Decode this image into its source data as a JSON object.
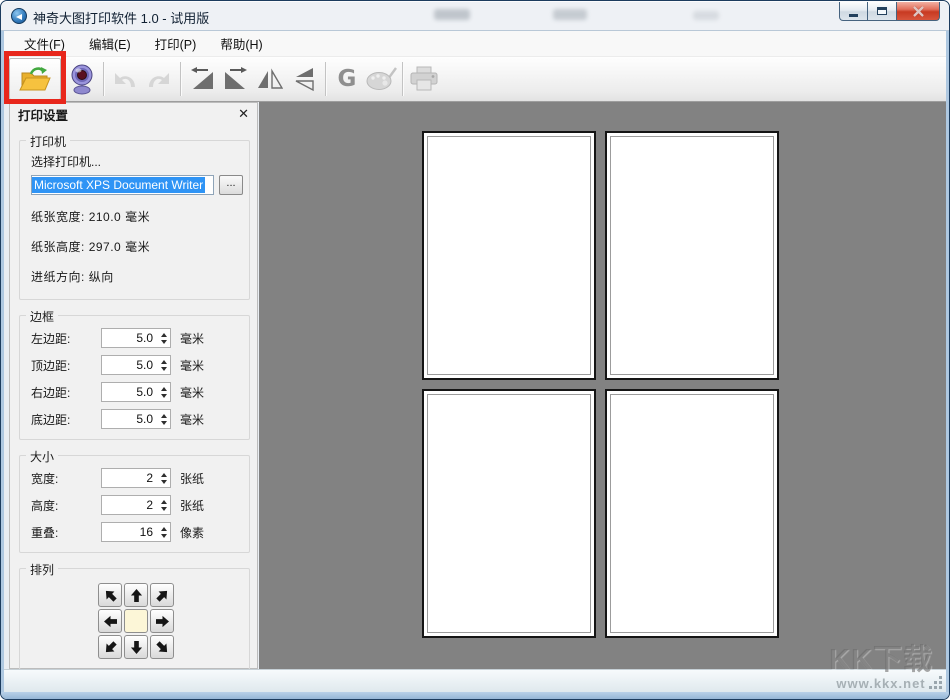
{
  "window": {
    "title": "神奇大图打印软件 1.0 - 试用版"
  },
  "menu": {
    "items": [
      {
        "label": "文件(F)"
      },
      {
        "label": "编辑(E)"
      },
      {
        "label": "打印(P)"
      },
      {
        "label": "帮助(H)"
      }
    ]
  },
  "toolbar": {
    "grayscale_label": "G"
  },
  "panel": {
    "title": "打印设置",
    "close_glyph": "✕",
    "printer_group": {
      "label": "打印机",
      "select_label": "选择打印机...",
      "printer_name": "Microsoft XPS Document Writer",
      "browse_label": "...",
      "paper_width": {
        "label": "纸张宽度:",
        "value": "210.0",
        "unit": "毫米"
      },
      "paper_height": {
        "label": "纸张高度:",
        "value": "297.0",
        "unit": "毫米"
      },
      "feed_direction": {
        "label": "进纸方向:",
        "value": "纵向",
        "unit": ""
      }
    },
    "margin_group": {
      "label": "边框",
      "rows": [
        {
          "label": "左边距:",
          "value": "5.0",
          "unit": "毫米"
        },
        {
          "label": "顶边距:",
          "value": "5.0",
          "unit": "毫米"
        },
        {
          "label": "右边距:",
          "value": "5.0",
          "unit": "毫米"
        },
        {
          "label": "底边距:",
          "value": "5.0",
          "unit": "毫米"
        }
      ]
    },
    "size_group": {
      "label": "大小",
      "rows": [
        {
          "label": "宽度:",
          "value": "2",
          "unit": "张纸"
        },
        {
          "label": "高度:",
          "value": "2",
          "unit": "张纸"
        },
        {
          "label": "重叠:",
          "value": "16",
          "unit": "像素"
        }
      ]
    },
    "arrange_group": {
      "label": "排列"
    }
  },
  "preview": {
    "page_count": 4,
    "grid_rows": 2,
    "grid_cols": 2
  },
  "watermark": {
    "title": "KK下载",
    "url": "www.kkx.net"
  },
  "colors": {
    "highlight_red": "#e8271c",
    "selection_blue": "#2f94f5",
    "preview_background": "#828282",
    "arrange_center": "#fcf6d7",
    "folder_yellow": "#f6c23f",
    "titlebar_blue": "#c2d7ea"
  }
}
